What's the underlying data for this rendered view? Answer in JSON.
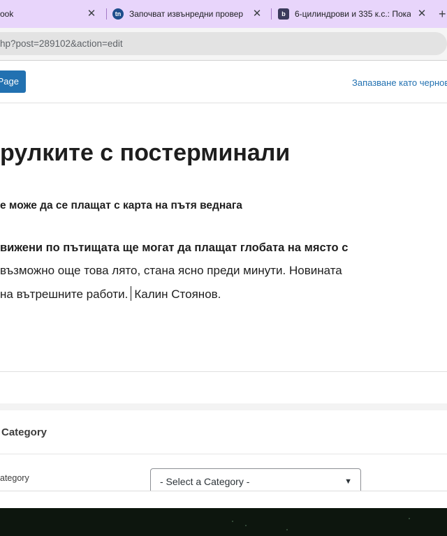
{
  "browser": {
    "tabs": [
      {
        "title": "ook",
        "favicon": "none"
      },
      {
        "title": "Започват извънредни провер",
        "favicon": "tn"
      },
      {
        "title": "6-цилиндрови и 335 к.с.: Пока",
        "favicon": "b"
      }
    ],
    "favicon_tn": "tn",
    "favicon_b": "b",
    "url": "hp?post=289102&action=edit",
    "accent_color": "#e8d5fb"
  },
  "editor": {
    "primary_button_label": "Page",
    "draft_link": "Запазване като чернов",
    "title": "рулките с постерминали",
    "subtitle": "е може да се плащат с карта на пътя веднага",
    "paragraph": {
      "line1": "вижени по пътищата ще могат да плащат глобата на място с",
      "line2": "възможно още това лято, стана ясно преди минути. Новината",
      "line3a": "на вътрешните работи.",
      "line3b": "Калин Стоянов."
    }
  },
  "category_panel": {
    "title": "Category",
    "field_label": "ategory",
    "select_value": "- Select a Category -"
  },
  "colors": {
    "primary": "#2271b1",
    "link": "#2271b1"
  }
}
